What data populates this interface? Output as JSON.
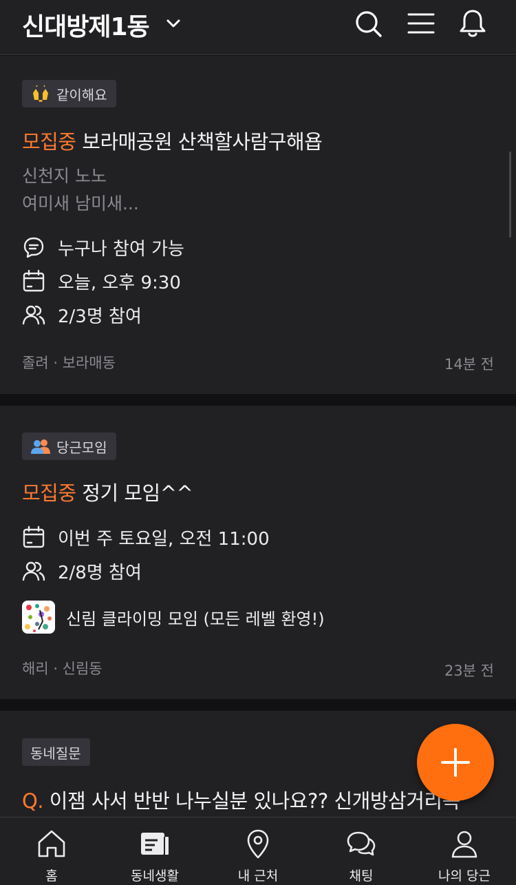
{
  "header": {
    "location": "신대방제1동",
    "icons": [
      "chevron-down-icon",
      "search-icon",
      "menu-icon",
      "bell-icon"
    ]
  },
  "posts": [
    {
      "badge": "같이해요",
      "badge_icon": "clapping-hands-icon",
      "status": "모집중",
      "title": "보라매공원 산책할사람구해욥",
      "desc": [
        "신천지 노노",
        "여미새 남미새..."
      ],
      "info": [
        {
          "icon": "chat-icon",
          "text": "누구나 참여 가능"
        },
        {
          "icon": "calendar-icon",
          "text": "오늘, 오후 9:30"
        },
        {
          "icon": "people-icon",
          "text": "2/3명 참여"
        }
      ],
      "author": "졸려 · 보라매동",
      "time": "14분 전"
    },
    {
      "badge": "당근모임",
      "badge_icon": "group-icon",
      "status": "모집중",
      "title": "정기 모임^^",
      "info": [
        {
          "icon": "calendar-icon",
          "text": "이번 주 토요일, 오전 11:00"
        },
        {
          "icon": "people-icon",
          "text": "2/8명 참여"
        }
      ],
      "group_name": "신림 클라이밍 모임 (모든 레벨 환영!)",
      "author": "해리 · 신림동",
      "time": "23분 전"
    },
    {
      "badge": "동네질문",
      "q_prefix": "Q.",
      "title": "이잼 사서 반반 나누실분 있나요?? 신개방삼거리쪽"
    }
  ],
  "tabs": [
    "홈",
    "동네생활",
    "내 근처",
    "채팅",
    "나의 당근"
  ],
  "colors": {
    "accent": "#ff6f0f",
    "recruit": "#ff7a2f",
    "background": "#212124"
  }
}
